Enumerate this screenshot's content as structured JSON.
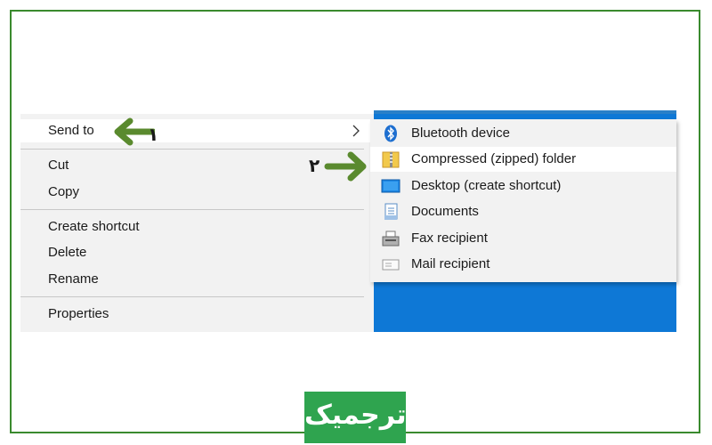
{
  "context_menu": {
    "items": [
      {
        "label": "Send to"
      },
      {
        "label": "Cut"
      },
      {
        "label": "Copy"
      },
      {
        "label": "Create shortcut"
      },
      {
        "label": "Delete"
      },
      {
        "label": "Rename"
      },
      {
        "label": "Properties"
      }
    ]
  },
  "send_to_menu": {
    "items": [
      {
        "label": "Bluetooth device",
        "icon": "bluetooth-icon"
      },
      {
        "label": "Compressed (zipped) folder",
        "icon": "zip-folder-icon"
      },
      {
        "label": "Desktop (create shortcut)",
        "icon": "desktop-icon"
      },
      {
        "label": "Documents",
        "icon": "documents-icon"
      },
      {
        "label": "Fax recipient",
        "icon": "fax-icon"
      },
      {
        "label": "Mail recipient",
        "icon": "mail-icon"
      }
    ]
  },
  "annotations": {
    "step1": "۱",
    "step2": "۲",
    "arrow_color": "#5a8a2e"
  },
  "logo": {
    "text": "ترجمیک",
    "color": "#2fa44f"
  },
  "colors": {
    "frame": "#3a8a2e",
    "desktop": "#0e78d6",
    "menu_bg": "#f2f2f2"
  }
}
